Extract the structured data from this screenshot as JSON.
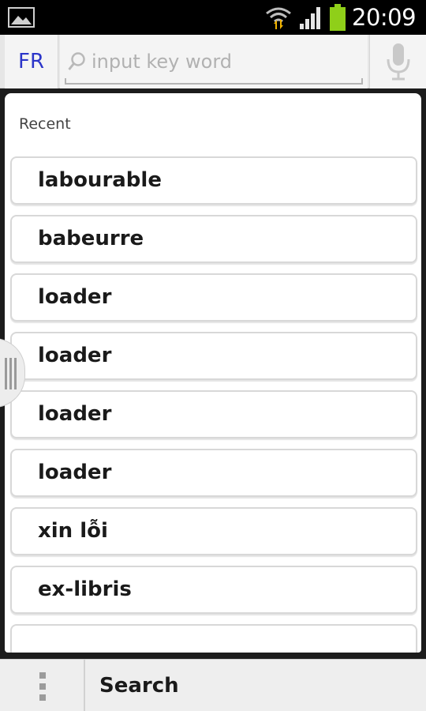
{
  "status_bar": {
    "time": "20:09",
    "icons": [
      "picture-icon",
      "wifi-icon",
      "signal-icon",
      "battery-icon"
    ],
    "battery_color": "#8fcf19"
  },
  "header": {
    "language": "FR",
    "search_placeholder": "input key word",
    "icons": [
      "search-icon",
      "microphone-icon"
    ]
  },
  "main": {
    "section_label": "Recent",
    "items": [
      {
        "label": "labourable"
      },
      {
        "label": "babeurre"
      },
      {
        "label": "loader"
      },
      {
        "label": "loader"
      },
      {
        "label": "loader"
      },
      {
        "label": "loader"
      },
      {
        "label": "xin lỗi"
      },
      {
        "label": "ex-libris"
      },
      {
        "label": ""
      }
    ]
  },
  "bottom_bar": {
    "search_label": "Search",
    "icons": [
      "overflow-menu-icon"
    ]
  },
  "colors": {
    "accent": "#2b35c9",
    "background": "#1c1c1c",
    "panel": "#ffffff"
  }
}
